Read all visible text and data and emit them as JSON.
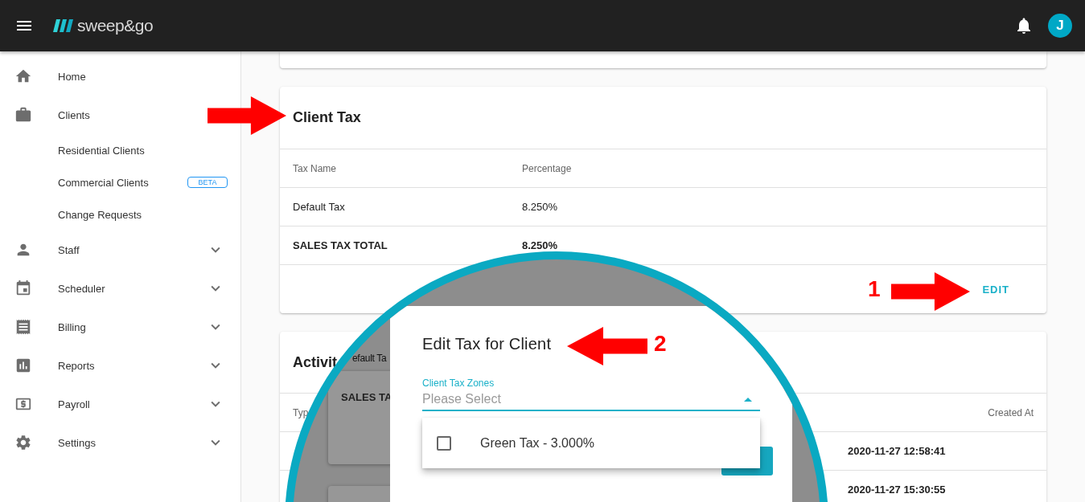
{
  "topbar": {
    "logo": "sweep&go",
    "avatar": "J"
  },
  "sidebar": {
    "items": [
      {
        "label": "Home",
        "expandable": false
      },
      {
        "label": "Clients",
        "expandable": false,
        "children": [
          {
            "label": "Residential Clients"
          },
          {
            "label": "Commercial Clients",
            "badge": "BETA"
          },
          {
            "label": "Change Requests"
          }
        ]
      },
      {
        "label": "Staff",
        "expandable": true
      },
      {
        "label": "Scheduler",
        "expandable": true
      },
      {
        "label": "Billing",
        "expandable": true
      },
      {
        "label": "Reports",
        "expandable": true
      },
      {
        "label": "Payroll",
        "expandable": true
      },
      {
        "label": "Settings",
        "expandable": true
      }
    ]
  },
  "client_tax": {
    "title": "Client Tax",
    "columns": [
      "Tax Name",
      "Percentage"
    ],
    "rows": [
      {
        "kind": "item",
        "cells": [
          "Default Tax",
          "8.250%"
        ]
      },
      {
        "kind": "total",
        "cells": [
          "SALES TAX TOTAL",
          "8.250%"
        ]
      }
    ],
    "action": "EDIT"
  },
  "activity": {
    "title": "Activit",
    "columns": [
      "Typ",
      "Created At"
    ],
    "rows": [
      {
        "created_at": "2020-11-27 12:58:41"
      },
      {
        "created_at": "2020-11-27 15:30:55"
      }
    ]
  },
  "magnifier": {
    "backdrop_texts": [
      "efault Ta",
      "SALES TA"
    ],
    "dialog": {
      "title": "Edit Tax for Client",
      "field": {
        "label": "Client Tax Zones",
        "placeholder": "Please Select",
        "open": true
      },
      "options": [
        {
          "label": "Green Tax - 3.000%",
          "checked": false
        }
      ]
    }
  },
  "annotations": [
    {
      "label": "1"
    },
    {
      "label": "2"
    }
  ]
}
